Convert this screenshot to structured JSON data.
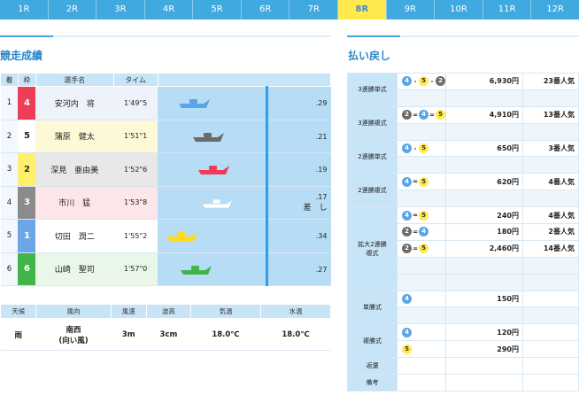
{
  "tabs": [
    "1R",
    "2R",
    "3R",
    "4R",
    "5R",
    "6R",
    "7R",
    "8R",
    "9R",
    "10R",
    "11R",
    "12R"
  ],
  "active_tab": "8R",
  "left_title": "競走成績",
  "right_title": "払い戻し",
  "results": {
    "headers": [
      "着",
      "枠",
      "選手名",
      "タイム"
    ],
    "rows": [
      {
        "rank": "1",
        "frame": "4",
        "name": "安河内　将",
        "time": "1'49\"5",
        "st": ".29",
        "note": "",
        "boat": 4
      },
      {
        "rank": "2",
        "frame": "5",
        "name": "蒲原　健太",
        "time": "1'51\"1",
        "st": ".21",
        "note": "",
        "boat": 2
      },
      {
        "rank": "3",
        "frame": "2",
        "name": "深見　亜由美",
        "time": "1'52\"6",
        "st": ".19",
        "note": "",
        "boat": 3
      },
      {
        "rank": "4",
        "frame": "3",
        "name": "市川　猛",
        "time": "1'53\"8",
        "st": ".17",
        "note": "差　し",
        "boat": 1
      },
      {
        "rank": "5",
        "frame": "1",
        "name": "切田　潤二",
        "time": "1'55\"2",
        "st": ".34",
        "note": "",
        "boat": 5
      },
      {
        "rank": "6",
        "frame": "6",
        "name": "山崎　聖司",
        "time": "1'57\"0",
        "st": ".27",
        "note": "",
        "boat": 6
      }
    ]
  },
  "weather": {
    "headers": [
      "天候",
      "風向",
      "風速",
      "波高",
      "気温",
      "水温"
    ],
    "values": [
      "雨",
      "南西\n(向い風)",
      "3m",
      "3cm",
      "18.0℃",
      "18.0℃"
    ]
  },
  "payouts": [
    {
      "type": "3連勝単式",
      "lines": [
        {
          "combo": [
            4,
            "-",
            5,
            "-",
            2
          ],
          "amount": "6,930円",
          "pop": "23番人気"
        }
      ],
      "blank": 1
    },
    {
      "type": "3連勝複式",
      "lines": [
        {
          "combo": [
            2,
            "=",
            4,
            "=",
            5
          ],
          "amount": "4,910円",
          "pop": "13番人気"
        }
      ],
      "blank": 1
    },
    {
      "type": "2連勝単式",
      "lines": [
        {
          "combo": [
            4,
            "-",
            5
          ],
          "amount": "650円",
          "pop": "3番人気"
        }
      ],
      "blank": 1
    },
    {
      "type": "2連勝複式",
      "lines": [
        {
          "combo": [
            4,
            "=",
            5
          ],
          "amount": "620円",
          "pop": "4番人気"
        }
      ],
      "blank": 1
    },
    {
      "type": "拡大2連勝\n複式",
      "lines": [
        {
          "combo": [
            4,
            "=",
            5
          ],
          "amount": "240円",
          "pop": "4番人気"
        },
        {
          "combo": [
            2,
            "=",
            4
          ],
          "amount": "180円",
          "pop": "2番人気"
        },
        {
          "combo": [
            2,
            "=",
            5
          ],
          "amount": "2,460円",
          "pop": "14番人気"
        }
      ],
      "blank": 2
    },
    {
      "type": "単勝式",
      "lines": [
        {
          "combo": [
            4
          ],
          "amount": "150円",
          "pop": ""
        }
      ],
      "blank": 1
    },
    {
      "type": "複勝式",
      "lines": [
        {
          "combo": [
            4
          ],
          "amount": "120円",
          "pop": ""
        },
        {
          "combo": [
            5
          ],
          "amount": "290円",
          "pop": ""
        }
      ],
      "blank": 0
    },
    {
      "type": "返還",
      "lines": [
        {
          "combo": [],
          "amount": "",
          "pop": ""
        }
      ],
      "blank": 0
    },
    {
      "type": "備考",
      "lines": [
        {
          "combo": [],
          "amount": "",
          "pop": ""
        }
      ],
      "blank": 0
    }
  ],
  "colors": {
    "accent": "#3fa9e0",
    "active_tab": "#ffe94d",
    "lane": "#b7dcf6"
  }
}
